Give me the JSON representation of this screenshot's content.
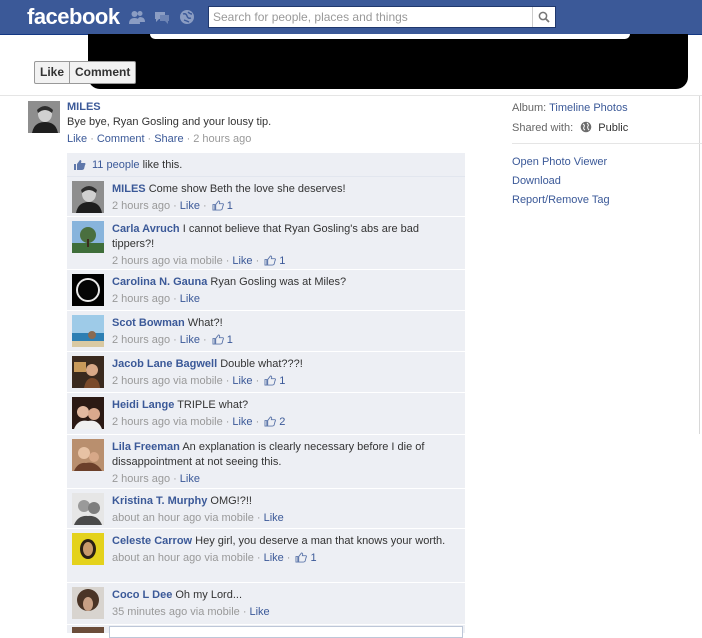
{
  "header": {
    "logo": "facebook",
    "search_placeholder": "Search for people, places and things"
  },
  "photo_actions": {
    "like": "Like",
    "comment": "Comment"
  },
  "post": {
    "author": "MILES",
    "text": "Bye bye, Ryan Gosling and your lousy tip.",
    "actions": {
      "like": "Like",
      "comment": "Comment",
      "share": "Share"
    },
    "time": "2 hours ago"
  },
  "likes": {
    "count_link": "11 people",
    "suffix": "like this."
  },
  "comments": [
    {
      "name": "MILES",
      "text": "Come show Beth the love she deserves!",
      "time": "2 hours ago",
      "via": "",
      "like": "Like",
      "likes": "1"
    },
    {
      "name": "Carla Avruch",
      "text": "I cannot believe that Ryan Gosling's abs are bad tippers?!",
      "time": "2 hours ago",
      "via": "via mobile",
      "like": "Like",
      "likes": "1"
    },
    {
      "name": "Carolina N. Gauna",
      "text": "Ryan Gosling was at Miles?",
      "time": "2 hours ago",
      "via": "",
      "like": "Like",
      "likes": ""
    },
    {
      "name": "Scot Bowman",
      "text": "What?!",
      "time": "2 hours ago",
      "via": "",
      "like": "Like",
      "likes": "1"
    },
    {
      "name": "Jacob Lane Bagwell",
      "text": "Double what???!",
      "time": "2 hours ago",
      "via": "via mobile",
      "like": "Like",
      "likes": "1"
    },
    {
      "name": "Heidi Lange",
      "text": "TRIPLE what?",
      "time": "2 hours ago",
      "via": "via mobile",
      "like": "Like",
      "likes": "2"
    },
    {
      "name": "Lila Freeman",
      "text": "An explanation is clearly necessary before I die of dissappointment at not seeing this.",
      "time": "2 hours ago",
      "via": "",
      "like": "Like",
      "likes": ""
    },
    {
      "name": "Kristina T. Murphy",
      "text": "OMG!?!!",
      "time": "about an hour ago",
      "via": "via mobile",
      "like": "Like",
      "likes": ""
    },
    {
      "name": "Celeste Carrow",
      "text": "Hey girl, you deserve a man that knows your worth.",
      "time": "about an hour ago",
      "via": "via mobile",
      "like": "Like",
      "likes": "1"
    },
    {
      "name": "Coco L Dee",
      "text": "Oh my Lord...",
      "time": "35 minutes ago",
      "via": "via mobile",
      "like": "Like",
      "likes": ""
    }
  ],
  "sidebar": {
    "album_label": "Album:",
    "album_value": "Timeline Photos",
    "shared_label": "Shared with:",
    "shared_value": "Public",
    "open_viewer": "Open Photo Viewer",
    "download": "Download",
    "report": "Report/Remove Tag"
  },
  "colors": {
    "brand": "#3b5998",
    "comment_bg": "#edeff4",
    "meta": "#999999"
  }
}
